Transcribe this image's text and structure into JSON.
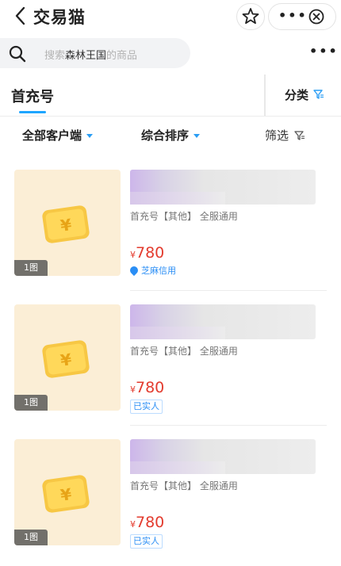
{
  "header": {
    "title": "交易猫"
  },
  "search": {
    "prefix": "搜索",
    "highlight": "森林王国",
    "suffix": "的商品"
  },
  "tabs": {
    "main": "首充号",
    "category": "分类"
  },
  "filters": {
    "clients": "全部客户端",
    "sort": "综合排序",
    "screen": "筛选"
  },
  "colors": {
    "accent": "#1ea5ff",
    "price": "#e33b2e",
    "thumb_bg": "#fbeed6"
  },
  "listings": [
    {
      "image_count": "1图",
      "meta": "首充号【其他】 全服通用",
      "currency": "¥",
      "price": "780",
      "badge": "芝麻信用",
      "badge_icon": "flame-icon"
    },
    {
      "image_count": "1图",
      "meta": "首充号【其他】 全服通用",
      "currency": "¥",
      "price": "780",
      "badge": "已实人"
    },
    {
      "image_count": "1图",
      "meta": "首充号【其他】 全服通用",
      "currency": "¥",
      "price": "780",
      "badge": "已实人"
    }
  ]
}
